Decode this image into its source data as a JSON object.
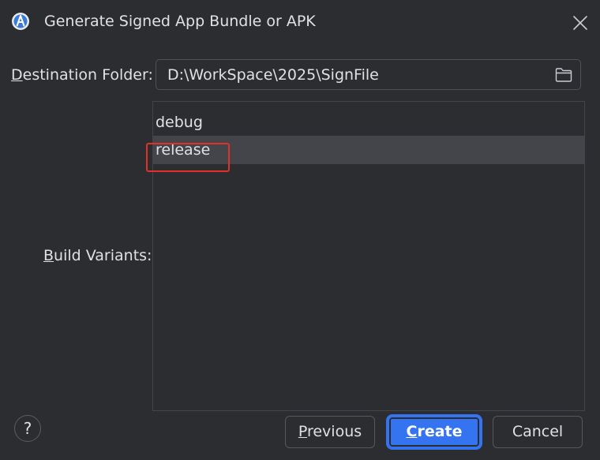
{
  "window": {
    "title": "Generate Signed App Bundle or APK",
    "icon": "android-studio-icon",
    "close_icon": "close-icon"
  },
  "destination": {
    "label_mnemonic": "D",
    "label_rest": "estination Folder:",
    "value": "D:\\WorkSpace\\2025\\SignFile",
    "browse_icon": "folder-icon"
  },
  "build_variants": {
    "label_mnemonic": "B",
    "label_rest": "uild Variants:",
    "items": [
      {
        "label": "debug",
        "selected": false
      },
      {
        "label": "release",
        "selected": true
      }
    ]
  },
  "footer": {
    "help_label": "?",
    "previous_mnemonic": "P",
    "previous_rest": "revious",
    "create_mnemonic": "C",
    "create_rest": "reate",
    "cancel_label": "Cancel"
  },
  "colors": {
    "background": "#2b2d30",
    "selection": "#43454a",
    "accent": "#3574f0",
    "annotation": "#e0312b"
  }
}
